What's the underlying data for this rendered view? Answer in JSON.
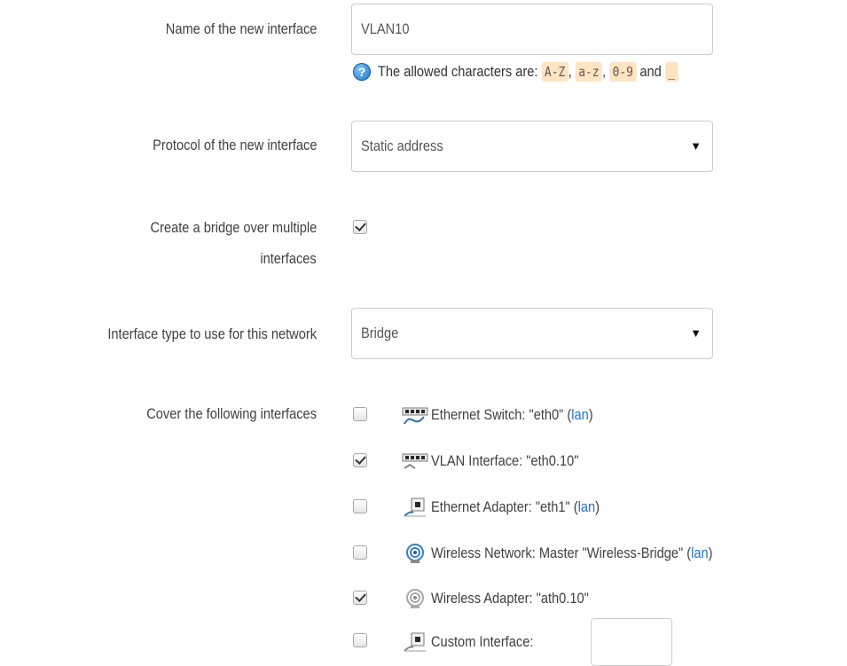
{
  "name_row": {
    "label": "Name of the new interface",
    "value": "VLAN10",
    "hint_prefix": "The allowed characters are:",
    "hint_codes": [
      "A-Z",
      "a-z",
      "0-9",
      "_"
    ],
    "hint_sep1": ",",
    "hint_sep2": ",",
    "hint_and": "and"
  },
  "protocol_row": {
    "label": "Protocol of the new interface",
    "selected": "Static address"
  },
  "bridge_row": {
    "label_line1": "Create a bridge over multiple",
    "label_line2": "interfaces",
    "checked": true
  },
  "type_row": {
    "label": "Interface type to use for this network",
    "selected": "Bridge"
  },
  "cover_row": {
    "label": "Cover the following interfaces",
    "items": [
      {
        "text": "Ethernet Switch: \"eth0\"",
        "link": "lan",
        "checked": false,
        "icon": "ethernet-switch-icon"
      },
      {
        "text": "VLAN Interface: \"eth0.10\"",
        "link": "",
        "checked": true,
        "icon": "vlan-interface-icon"
      },
      {
        "text": "Ethernet Adapter: \"eth1\"",
        "link": "lan",
        "checked": false,
        "icon": "ethernet-adapter-icon"
      },
      {
        "text": "Wireless Network: Master \"Wireless-Bridge\"",
        "link": "lan",
        "checked": false,
        "icon": "wireless-network-icon"
      },
      {
        "text": "Wireless Adapter: \"ath0.10\"",
        "link": "",
        "checked": true,
        "icon": "wireless-adapter-icon"
      },
      {
        "text": "Custom Interface:",
        "link": "",
        "checked": false,
        "icon": "custom-interface-icon"
      }
    ]
  },
  "colors": {
    "link": "#1e73d2",
    "code_bg": "#ffe4c2",
    "text": "#404040"
  }
}
